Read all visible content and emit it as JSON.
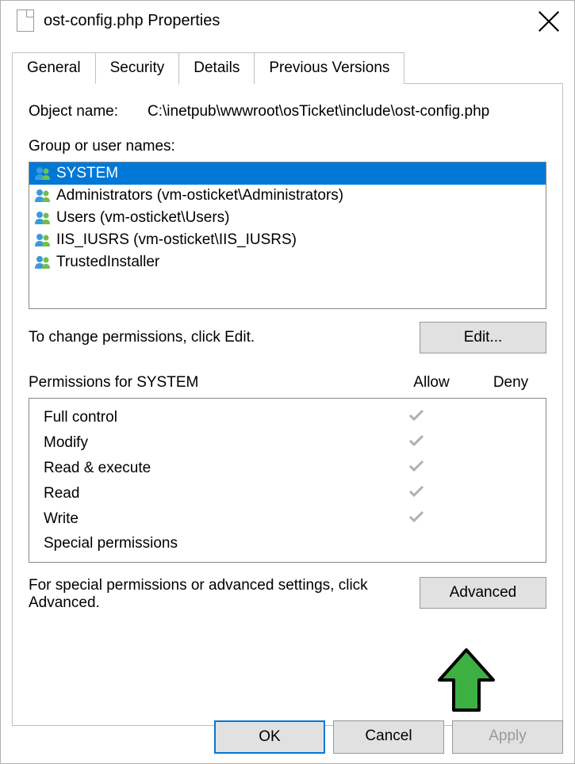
{
  "window": {
    "title": "ost-config.php Properties"
  },
  "tabs": [
    {
      "label": "General"
    },
    {
      "label": "Security"
    },
    {
      "label": "Details"
    },
    {
      "label": "Previous Versions"
    }
  ],
  "active_tab": 1,
  "object_name_label": "Object name:",
  "object_name_value": "C:\\inetpub\\wwwroot\\osTicket\\include\\ost-config.php",
  "group_label": "Group or user names:",
  "users": [
    {
      "name": "SYSTEM",
      "selected": true,
      "iconType": "system"
    },
    {
      "name": "Administrators (vm-osticket\\Administrators)",
      "selected": false,
      "iconType": "group"
    },
    {
      "name": "Users (vm-osticket\\Users)",
      "selected": false,
      "iconType": "group"
    },
    {
      "name": "IIS_IUSRS (vm-osticket\\IIS_IUSRS)",
      "selected": false,
      "iconType": "group"
    },
    {
      "name": "TrustedInstaller",
      "selected": false,
      "iconType": "group"
    }
  ],
  "edit_text": "To change permissions, click Edit.",
  "edit_button": "Edit...",
  "permissions_for_label": "Permissions for SYSTEM",
  "allow_label": "Allow",
  "deny_label": "Deny",
  "permissions": [
    {
      "name": "Full control",
      "allow": true,
      "deny": false
    },
    {
      "name": "Modify",
      "allow": true,
      "deny": false
    },
    {
      "name": "Read & execute",
      "allow": true,
      "deny": false
    },
    {
      "name": "Read",
      "allow": true,
      "deny": false
    },
    {
      "name": "Write",
      "allow": true,
      "deny": false
    },
    {
      "name": "Special permissions",
      "allow": false,
      "deny": false
    }
  ],
  "advanced_text": "For special permissions or advanced settings, click Advanced.",
  "advanced_button": "Advanced",
  "footer": {
    "ok": "OK",
    "cancel": "Cancel",
    "apply": "Apply"
  }
}
